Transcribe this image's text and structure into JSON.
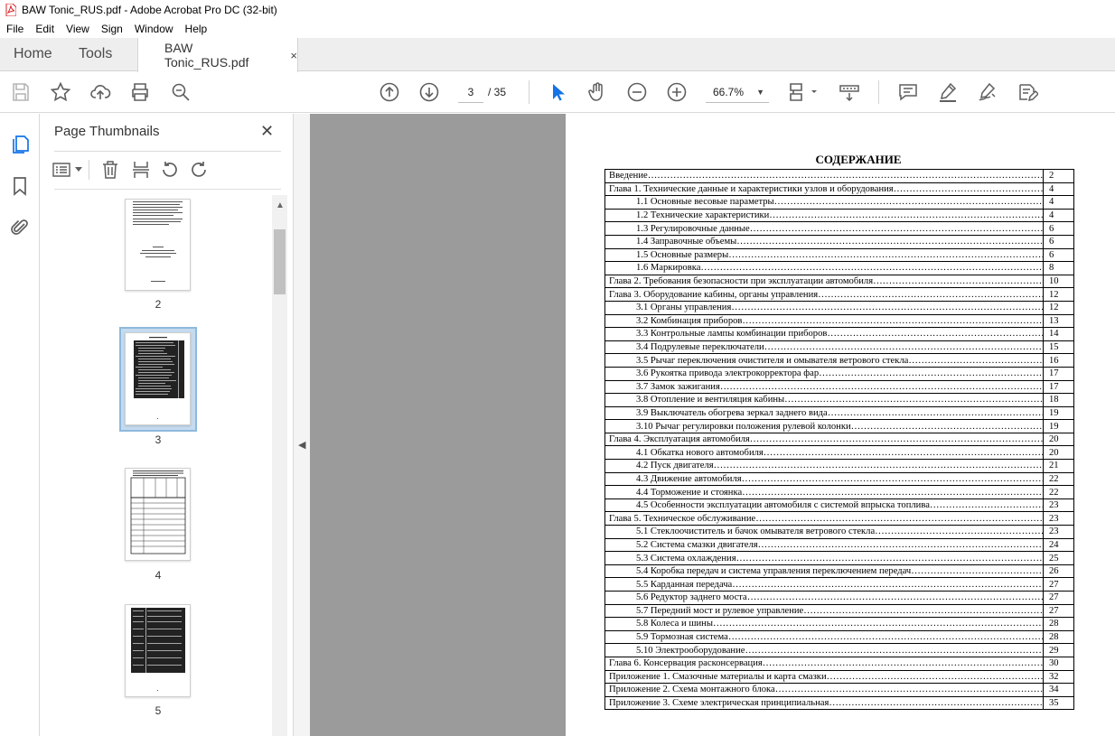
{
  "window": {
    "title": "BAW Tonic_RUS.pdf - Adobe Acrobat Pro DC (32-bit)"
  },
  "menu": [
    "File",
    "Edit",
    "View",
    "Sign",
    "Window",
    "Help"
  ],
  "tabs": {
    "home": "Home",
    "tools": "Tools",
    "document": "BAW Tonic_RUS.pdf",
    "close": "×"
  },
  "nav": {
    "page_current": "3",
    "page_total": "/ 35",
    "zoom": "66.7%"
  },
  "panel": {
    "title": "Page Thumbnails",
    "thumbnails": [
      {
        "label": "2"
      },
      {
        "label": "3",
        "selected": true
      },
      {
        "label": "4"
      },
      {
        "label": "5"
      }
    ]
  },
  "document": {
    "heading": "СОДЕРЖАНИЕ",
    "toc": [
      {
        "level": 1,
        "title": "Введение",
        "page": "2"
      },
      {
        "level": 1,
        "title": "Глава 1. Технические данные и характеристики узлов и оборудования",
        "page": "4"
      },
      {
        "level": 2,
        "title": "1.1 Основные весовые параметры",
        "page": "4"
      },
      {
        "level": 2,
        "title": "1.2 Технические характеристики",
        "page": "4"
      },
      {
        "level": 2,
        "title": "1.3 Регулировочные данные",
        "page": "6"
      },
      {
        "level": 2,
        "title": "1.4 Заправочные объемы",
        "page": "6"
      },
      {
        "level": 2,
        "title": "1.5 Основные размеры",
        "page": "6"
      },
      {
        "level": 2,
        "title": "1.6 Маркировка",
        "page": "8"
      },
      {
        "level": 1,
        "title": "Глава 2. Требования безопасности при эксплуатации автомобиля",
        "page": "10"
      },
      {
        "level": 1,
        "title": "Глава 3. Оборудование кабины, органы управления",
        "page": "12"
      },
      {
        "level": 2,
        "title": "3.1 Органы управления",
        "page": "12"
      },
      {
        "level": 2,
        "title": "3.2 Комбинация приборов",
        "page": "13"
      },
      {
        "level": 2,
        "title": "3.3 Контрольные лампы комбинации приборов",
        "page": "14"
      },
      {
        "level": 2,
        "title": "3.4 Подрулевые переключатели",
        "page": "15"
      },
      {
        "level": 2,
        "title": "3.5 Рычаг переключения очистителя и омывателя ветрового стекла",
        "page": "16"
      },
      {
        "level": 2,
        "title": "3.6 Рукоятка привода электрокорректора фар",
        "page": "17"
      },
      {
        "level": 2,
        "title": "3.7 Замок зажигания",
        "page": "17"
      },
      {
        "level": 2,
        "title": "3.8 Отопление и вентиляция кабины",
        "page": "18"
      },
      {
        "level": 2,
        "title": "3.9 Выключатель обогрева зеркал заднего вида",
        "page": "19"
      },
      {
        "level": 2,
        "title": "3.10 Рычаг регулировки положения рулевой колонки",
        "page": "19"
      },
      {
        "level": 1,
        "title": "Глава 4. Эксплуатация автомобиля",
        "page": "20"
      },
      {
        "level": 2,
        "title": "4.1 Обкатка нового автомобиля",
        "page": "20"
      },
      {
        "level": 2,
        "title": "4.2 Пуск двигателя",
        "page": "21"
      },
      {
        "level": 2,
        "title": "4.3 Движение автомобиля",
        "page": "22"
      },
      {
        "level": 2,
        "title": "4.4 Торможение и стоянка",
        "page": "22"
      },
      {
        "level": 2,
        "title": "4.5 Особенности эксплуатации автомобиля с системой впрыска топлива",
        "page": "23"
      },
      {
        "level": 1,
        "title": "Глава 5. Техническое обслуживание",
        "page": "23"
      },
      {
        "level": 2,
        "title": "5.1 Стеклоочиститель и бачок омывателя ветрового стекла",
        "page": "23"
      },
      {
        "level": 2,
        "title": "5.2 Система смазки двигателя",
        "page": "24"
      },
      {
        "level": 2,
        "title": "5.3 Система охлаждения",
        "page": "25"
      },
      {
        "level": 2,
        "title": "5.4 Коробка передач и система управления переключением передач",
        "page": "26"
      },
      {
        "level": 2,
        "title": "5.5 Карданная передача",
        "page": "27"
      },
      {
        "level": 2,
        "title": "5.6 Редуктор заднего моста",
        "page": "27"
      },
      {
        "level": 2,
        "title": "5.7 Передний мост и рулевое управление",
        "page": "27"
      },
      {
        "level": 2,
        "title": "5.8 Колеса и шины",
        "page": "28"
      },
      {
        "level": 2,
        "title": "5.9 Тормозная система",
        "page": "28"
      },
      {
        "level": 2,
        "title": "5.10 Электрооборудование",
        "page": "29"
      },
      {
        "level": 1,
        "title": "Глава 6. Консервация расконсервация",
        "page": "30"
      },
      {
        "level": 1,
        "title": "Приложение 1. Смазочные материалы и карта смазки",
        "page": "32"
      },
      {
        "level": 1,
        "title": "Приложение 2. Схема монтажного блока",
        "page": "34"
      },
      {
        "level": 1,
        "title": "Приложение 3. Схеме электрическая принципиальная",
        "page": "35"
      }
    ]
  },
  "icons": {
    "colors": {
      "accent": "#1473e6",
      "pdf_red": "#d9252a",
      "toolbar_grey": "#6e6e6e"
    }
  }
}
